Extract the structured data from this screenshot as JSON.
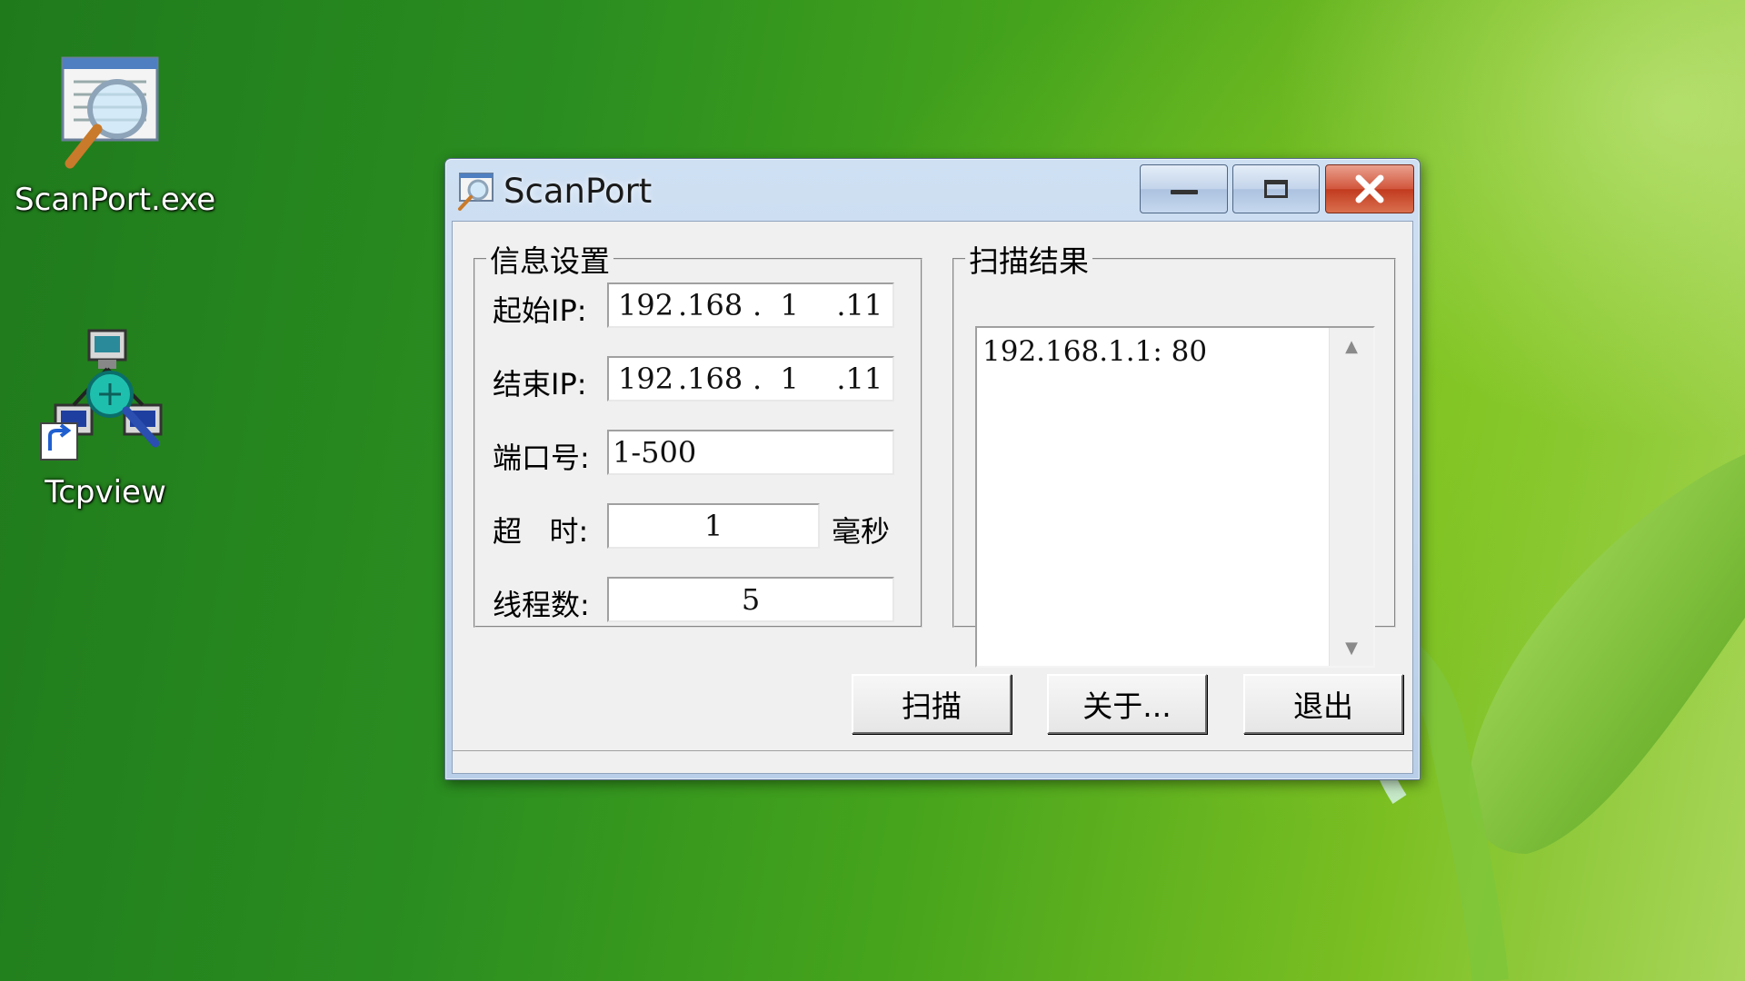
{
  "desktop": {
    "icons": [
      {
        "label": "ScanPort.exe",
        "icon": "magnifier-window-icon"
      },
      {
        "label": "Tcpview",
        "icon": "network-computers-icon"
      }
    ]
  },
  "window": {
    "title": "ScanPort",
    "controls": {
      "minimize": "minimize-icon",
      "maximize": "maximize-icon",
      "close": "close-icon"
    },
    "settings": {
      "legend": "信息设置",
      "start_ip_label": "起始IP:",
      "start_ip": [
        "192",
        ".168",
        ".  1",
        "  .11"
      ],
      "end_ip_label": "结束IP:",
      "end_ip": [
        "192",
        ".168",
        ".  1",
        "  .11"
      ],
      "port_label": "端口号:",
      "port_value": "1-500",
      "timeout_label": "超   时:",
      "timeout_value": "1",
      "timeout_unit": "毫秒",
      "threads_label": "线程数:",
      "threads_value": "5"
    },
    "results": {
      "legend": "扫描结果",
      "lines": [
        "192.168.1.1: 80"
      ]
    },
    "buttons": {
      "scan": "扫描",
      "about": "关于...",
      "exit": "退出"
    }
  },
  "colors": {
    "title_bar": "#c4d7ee",
    "close_button": "#c7452a",
    "desktop_green": "#2a8d20"
  }
}
